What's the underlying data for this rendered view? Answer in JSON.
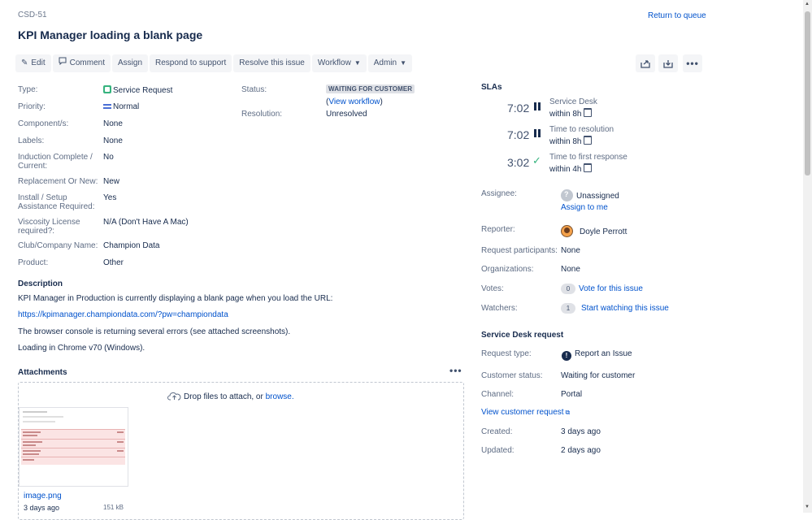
{
  "issue": {
    "key": "CSD-51",
    "title": "KPI Manager loading a blank page",
    "return_link": "Return to queue"
  },
  "toolbar": {
    "edit": "Edit",
    "comment": "Comment",
    "assign": "Assign",
    "respond": "Respond to support",
    "resolve": "Resolve this issue",
    "workflow": "Workflow",
    "admin": "Admin"
  },
  "details": {
    "type_label": "Type:",
    "type_value": "Service Request",
    "priority_label": "Priority:",
    "priority_value": "Normal",
    "components_label": "Component/s:",
    "components_value": "None",
    "labels_label": "Labels:",
    "labels_value": "None",
    "induction_label_1": "Induction Complete /",
    "induction_label_2": "Current:",
    "induction_value": "No",
    "replacement_label": "Replacement Or New:",
    "replacement_value": "New",
    "install_label_1": "Install / Setup",
    "install_label_2": "Assistance Required:",
    "install_value": "Yes",
    "viscosity_label_1": "Viscosity License",
    "viscosity_label_2": "required?:",
    "viscosity_value": "N/A (Don't Have A Mac)",
    "club_label": "Club/Company Name:",
    "club_value": "Champion Data",
    "product_label": "Product:",
    "product_value": "Other",
    "status_label": "Status:",
    "status_value": "WAITING FOR CUSTOMER",
    "view_workflow_open": "(",
    "view_workflow": "View workflow",
    "view_workflow_close": ")",
    "resolution_label": "Resolution:",
    "resolution_value": "Unresolved"
  },
  "description": {
    "heading": "Description",
    "line1": "KPI Manager in Production is currently displaying a blank page when you load the URL:",
    "url": "https://kpimanager.championdata.com/?pw=championdata",
    "line2": "The browser console is returning several errors (see attached screenshots).",
    "line3": "Loading in Chrome v70 (Windows)."
  },
  "attachments": {
    "heading": "Attachments",
    "drop_text": "Drop files to attach, or",
    "browse": "browse.",
    "file_name": "image.png",
    "file_date": "3 days ago",
    "file_size": "151 kB"
  },
  "slas": {
    "heading": "SLAs",
    "items": [
      {
        "time": "7:02",
        "name": "Service Desk",
        "goal": "within 8h",
        "state": "paused"
      },
      {
        "time": "7:02",
        "name": "Time to resolution",
        "goal": "within 8h",
        "state": "paused"
      },
      {
        "time": "3:02",
        "name": "Time to first response",
        "goal": "within 4h",
        "state": "met"
      }
    ]
  },
  "people": {
    "assignee_label": "Assignee:",
    "assignee_value": "Unassigned",
    "assign_to_me": "Assign to me",
    "reporter_label": "Reporter:",
    "reporter_value": "Doyle Perrott",
    "participants_label": "Request participants:",
    "participants_value": "None",
    "orgs_label": "Organizations:",
    "orgs_value": "None",
    "votes_label": "Votes:",
    "votes_count": "0",
    "votes_link": "Vote for this issue",
    "watchers_label": "Watchers:",
    "watchers_count": "1",
    "watchers_link": "Start watching this issue"
  },
  "sd_request": {
    "heading": "Service Desk request",
    "type_label": "Request type:",
    "type_value": "Report an Issue",
    "customer_status_label": "Customer status:",
    "customer_status_value": "Waiting for customer",
    "channel_label": "Channel:",
    "channel_value": "Portal",
    "view_customer_request": "View customer request",
    "created_label": "Created:",
    "created_value": "3 days ago",
    "updated_label": "Updated:",
    "updated_value": "2 days ago"
  },
  "colors": {
    "link": "#0052cc",
    "text": "#172b4d",
    "muted": "#5e6c84",
    "success": "#36b37e"
  }
}
